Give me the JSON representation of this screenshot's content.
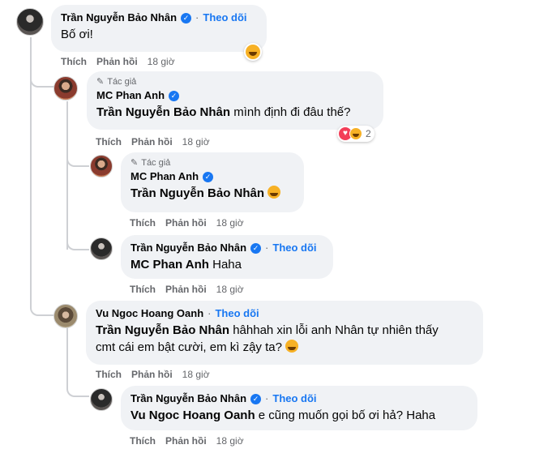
{
  "comments": [
    {
      "author": "Trần Nguyễn Bảo Nhân",
      "follow": "Theo dõi",
      "text": "Bố ơi!",
      "actions": {
        "like": "Thích",
        "reply": "Phản hồi",
        "time": "18 giờ"
      }
    },
    {
      "author_tag": "Tác giả",
      "author": "MC Phan Anh",
      "mention": "Trần Nguyễn Bảo Nhân",
      "text": " mình định đi đâu thế?",
      "reaction_count": "2",
      "actions": {
        "like": "Thích",
        "reply": "Phản hồi",
        "time": "18 giờ"
      }
    },
    {
      "author_tag": "Tác giả",
      "author": "MC Phan Anh",
      "mention": "Trần Nguyễn Bảo Nhân",
      "text": "",
      "actions": {
        "like": "Thích",
        "reply": "Phản hồi",
        "time": "18 giờ"
      }
    },
    {
      "author": "Trần Nguyễn Bảo Nhân",
      "follow": "Theo dõi",
      "mention": "MC Phan Anh",
      "text": " Haha",
      "actions": {
        "like": "Thích",
        "reply": "Phản hồi",
        "time": "18 giờ"
      }
    },
    {
      "author": "Vu Ngoc Hoang Oanh",
      "follow": "Theo dõi",
      "mention": "Trần Nguyễn Bảo Nhân",
      "text_line1": " hâhhah xin lỗi anh Nhân tự nhiên thấy",
      "text_line2": "cmt cái em bật cười, em kì zậy ta?",
      "actions": {
        "like": "Thích",
        "reply": "Phản hồi",
        "time": "18 giờ"
      }
    },
    {
      "author": "Trần Nguyễn Bảo Nhân",
      "follow": "Theo dõi",
      "mention": "Vu Ngoc Hoang Oanh",
      "text": " e cũng muốn gọi bố ơi hả? Haha",
      "actions": {
        "like": "Thích",
        "reply": "Phản hồi",
        "time": "18 giờ"
      }
    }
  ],
  "icons": {
    "verified": "verified-badge-icon",
    "author_tag": "pencil-icon",
    "emoji": "laughing-emoji-icon",
    "reactions": [
      "heart-icon",
      "haha-icon"
    ]
  },
  "colors": {
    "link": "#1877f2",
    "bubble": "#f0f2f5",
    "muted": "#65676b"
  }
}
